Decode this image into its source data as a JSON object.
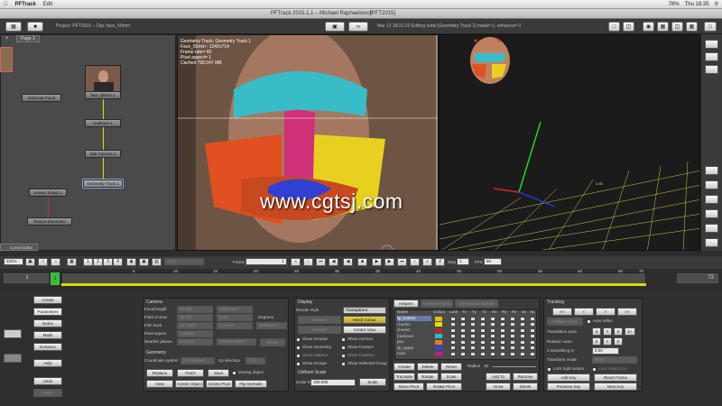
{
  "menubar": {
    "apple": "",
    "app": "PFTrack",
    "edit": "Edit",
    "clock": "Thu 18:35",
    "battery": "78%"
  },
  "window": {
    "title": "PFTrack 2015.1.1 – Michael Raphaelovich",
    "badge": "[PFT2015]"
  },
  "project": {
    "label": "Project: PFT2015 – Clip: face_50mm"
  },
  "editmode": {
    "label": "Mar 12 18:21:22 Editing node [Geometry Track 1] mask= 0, enhance= 0"
  },
  "tree": {
    "page_tab": "Page 1",
    "nodes": [
      "Estimate Focal",
      "face_50mm 1",
      "Undistort 1",
      "Edit Camera 1",
      "Geometry Track 1",
      "Survey Solver 1",
      "Texture Extraction"
    ],
    "curve_editor": "Curve Editor"
  },
  "viewer": {
    "info": [
      "Geometry Track: Geometry Track 1",
      "Face_50mm : 1242x714",
      "Frame rate= 60",
      "Pixel aspect= 1",
      "Cached 758.047 MB"
    ],
    "watermark": "www.cgtsj.com",
    "grid_label": "1 m"
  },
  "timeline": {
    "zoom": "222%",
    "numbers": [
      "1",
      "2",
      "3",
      "4"
    ],
    "mode": "Auto",
    "frame_label": "Frame",
    "frame_value": "1",
    "step_label": "Step",
    "step_value": "1",
    "fps_label": "FPS",
    "fps_value": "60",
    "start": "1",
    "end": "72",
    "current": "1",
    "ticks": [
      "5",
      "10",
      "15",
      "20",
      "25",
      "30",
      "35",
      "40",
      "45",
      "50",
      "55",
      "60",
      "65",
      "70"
    ]
  },
  "sidemenu": [
    "Create",
    "Parameters",
    "Notes",
    "Mask",
    "Enhance",
    "Help",
    "Undo",
    "Redo"
  ],
  "camera": {
    "title": "Camera",
    "rows": [
      {
        "label": "Focal length",
        "value": "50.000",
        "unit": "Millimeters"
      },
      {
        "label": "Field of view",
        "value": "38.297",
        "unit": "8.411",
        "extra": "Degrees"
      },
      {
        "label": "Film back",
        "value": "24.31871",
        "unit": "6.21153",
        "extra": "Millimeters"
      },
      {
        "label": "Pixel aspect",
        "value": "1.00000"
      },
      {
        "label": "Near/far planes",
        "value": "0.01000",
        "unit": "100000.00000",
        "extra": "Reset"
      }
    ]
  },
  "geometry": {
    "title": "Geometry",
    "coord_label": "Coordinate system",
    "coord_value": "Left-handed",
    "up_label": "Up direction",
    "up_value": "Y Up",
    "buttons": [
      "Replace",
      "Fetch",
      "Save",
      "View",
      "Centre Object",
      "Centre Pivot",
      "Flip Normals"
    ],
    "moving": "Moving object"
  },
  "display": {
    "title": "Display",
    "render_label": "Render style",
    "render_value": "Transparent",
    "checker": "Checker",
    "mesh": "Mesh Colour",
    "shaded": "Shaded",
    "centre": "Centre View",
    "checks": [
      "Show Ground",
      "Show Horizon",
      "Show Geometry",
      "Show Frustum",
      "Show Helpers",
      "Show Trackers",
      "Show Groups",
      "Show Selected Group"
    ],
    "uniform_title": "Uniform Scale",
    "scale_label": "Scale N",
    "scale_value": "100.000",
    "scale_btn": "Scale"
  },
  "helpers": {
    "tabs": [
      "Helpers",
      "Vertex Weights",
      "Deformable Groups"
    ],
    "columns": [
      "Name",
      "Colour",
      "Lock",
      "Tx",
      "Ty",
      "Tz",
      "Rx",
      "Ry",
      "Rz",
      "Sx",
      "Sy",
      "Sz"
    ],
    "rows": [
      {
        "name": "lip_bottom",
        "color": "#e0c000"
      },
      {
        "name": "cheek1",
        "color": "#e0e000"
      },
      {
        "name": "cheek2",
        "color": "#c02030"
      },
      {
        "name": "forehead",
        "color": "#20c0c0"
      },
      {
        "name": "jaw",
        "color": "#e08020"
      },
      {
        "name": "lip_upper",
        "color": "#4040d0"
      },
      {
        "name": "nose",
        "color": "#c02080"
      }
    ],
    "buttons": [
      "Create",
      "Delete",
      "Reset",
      "Translate",
      "Rotate",
      "Scale",
      "Move Pivot",
      "Rotate Pivot",
      "Add To",
      "Remove From",
      "Grow",
      "Shrink"
    ],
    "radius_label": "Radius",
    "radius_value": "15"
  },
  "tracking": {
    "title": "Tracking",
    "nav": [
      "<<",
      "<",
      ">",
      ">>"
    ],
    "refine_group": "Refine Group",
    "auto_refine": "Auto refine",
    "translation": "Translation axes",
    "rotation": "Rotation axes",
    "smoothing": "2 Smoothing N",
    "smoothing_value": "0.00",
    "transform_mode": "Transform mode",
    "transform_value": "None",
    "lock_rigid": "Lock rigid motion",
    "lock_shape": "Lock object size",
    "axes": [
      "X",
      "Y",
      "Z",
      "Z+"
    ],
    "buttons": [
      "Add Key",
      "Reset Frame",
      "Previous Key",
      "Next Key"
    ]
  }
}
